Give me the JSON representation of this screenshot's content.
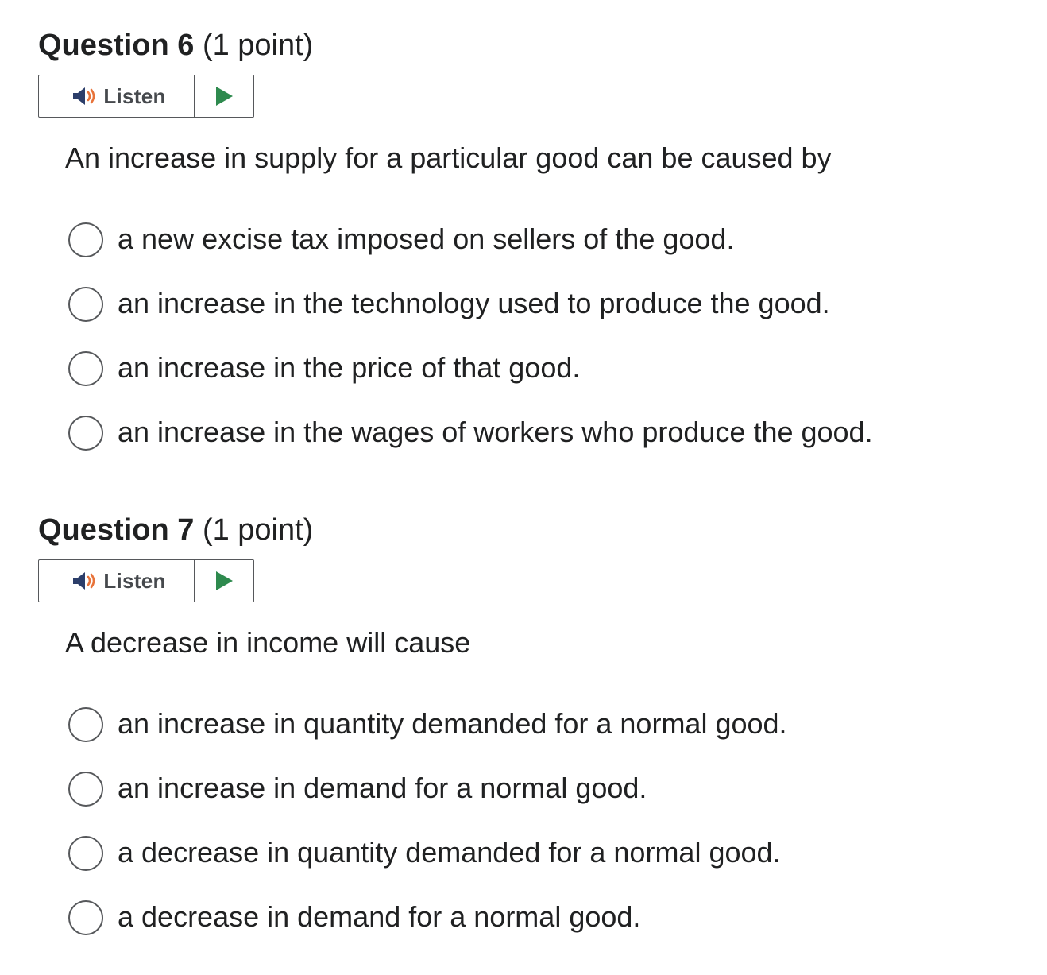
{
  "questions": [
    {
      "title": "Question 6",
      "points": "(1 point)",
      "listen_label": "Listen",
      "prompt": "An increase in supply for a particular good can be caused by",
      "options": [
        "a new excise tax imposed on sellers of the good.",
        "an increase in the technology used to produce the good.",
        "an increase in the price of that good.",
        "an increase in the wages of workers who produce the good."
      ]
    },
    {
      "title": "Question 7",
      "points": "(1 point)",
      "listen_label": "Listen",
      "prompt": "A decrease in income will cause",
      "options": [
        "an increase in quantity demanded for a normal good.",
        "an increase in demand for a normal good.",
        "a decrease in quantity demanded for a normal good.",
        "a decrease in demand for a normal good."
      ]
    }
  ],
  "icons": {
    "speaker": "speaker-icon",
    "play": "play-icon"
  },
  "colors": {
    "text": "#202122",
    "speaker_body": "#2c3e6a",
    "speaker_waves": "#e8733a",
    "play": "#2e8a4e",
    "border": "#56585b"
  }
}
